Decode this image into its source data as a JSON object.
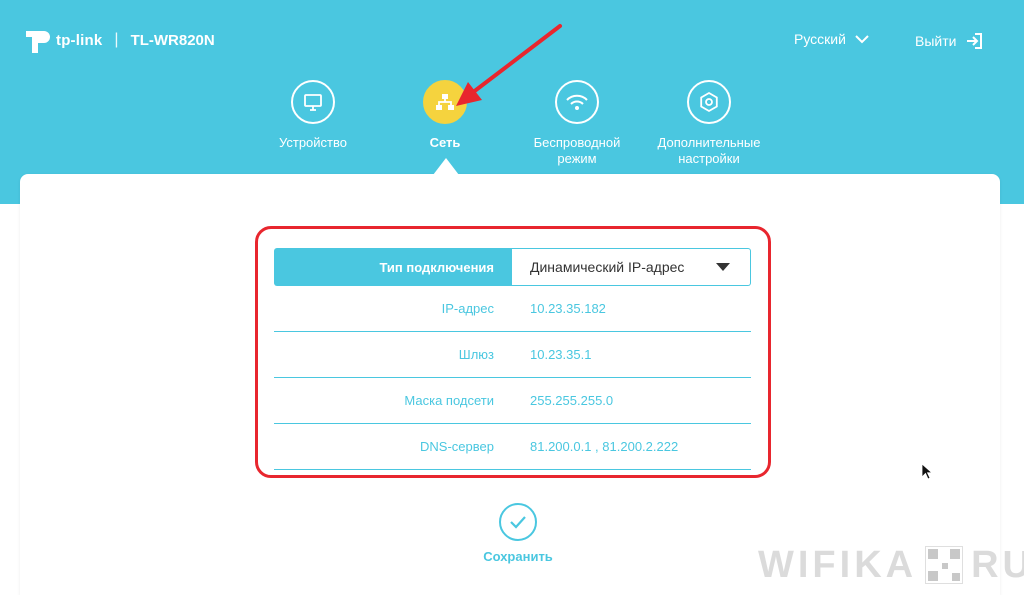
{
  "header": {
    "brand": "tp-link",
    "separator": "|",
    "model": "TL-WR820N",
    "language": "Русский",
    "logout": "Выйти"
  },
  "nav": {
    "items": [
      {
        "label": "Устройство",
        "icon": "monitor-icon"
      },
      {
        "label": "Сеть",
        "icon": "network-icon",
        "active": true
      },
      {
        "label": "Беспроводной режим",
        "icon": "wifi-icon"
      },
      {
        "label": "Дополнительные настройки",
        "icon": "gear-icon"
      }
    ]
  },
  "form": {
    "connection_type_label": "Тип подключения",
    "connection_type_value": "Динамический IP-адрес",
    "rows": [
      {
        "label": "IP-адрес",
        "value": "10.23.35.182"
      },
      {
        "label": "Шлюз",
        "value": "10.23.35.1"
      },
      {
        "label": "Маска подсети",
        "value": "255.255.255.0"
      },
      {
        "label": "DNS-сервер",
        "value": "81.200.0.1 , 81.200.2.222"
      }
    ]
  },
  "save": {
    "label": "Сохранить"
  },
  "watermark": {
    "left": "WIFIKA",
    "right": "RU"
  },
  "colors": {
    "accent": "#4ac7e0",
    "active": "#f5d33e",
    "annotation": "#e8262e"
  }
}
